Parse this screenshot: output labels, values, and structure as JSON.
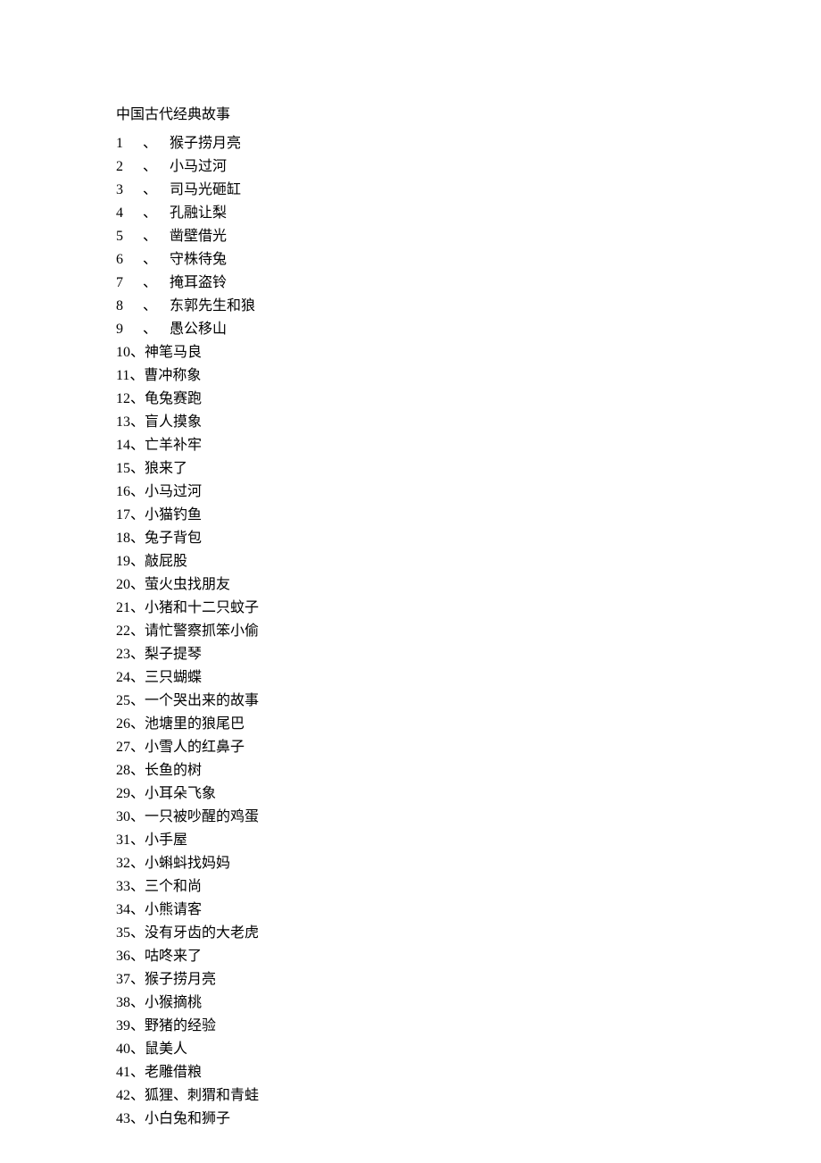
{
  "title": "中国古代经典故事",
  "items": [
    {
      "num": "1",
      "sep": "、",
      "text": "猴子捞月亮"
    },
    {
      "num": "2",
      "sep": "、",
      "text": "小马过河"
    },
    {
      "num": "3",
      "sep": "、",
      "text": "司马光砸缸"
    },
    {
      "num": "4",
      "sep": "、",
      "text": "孔融让梨"
    },
    {
      "num": "5",
      "sep": "、",
      "text": "凿壁借光"
    },
    {
      "num": "6",
      "sep": "、",
      "text": "守株待兔"
    },
    {
      "num": "7",
      "sep": "、",
      "text": "掩耳盗铃"
    },
    {
      "num": "8",
      "sep": "、",
      "text": "东郭先生和狼"
    },
    {
      "num": "9",
      "sep": "、",
      "text": "愚公移山"
    },
    {
      "num": "10",
      "sep": "、",
      "text": "神笔马良"
    },
    {
      "num": "11",
      "sep": "、",
      "text": "曹冲称象"
    },
    {
      "num": "12",
      "sep": "、",
      "text": "龟兔赛跑"
    },
    {
      "num": "13",
      "sep": "、",
      "text": "盲人摸象"
    },
    {
      "num": "14",
      "sep": "、",
      "text": "亡羊补牢"
    },
    {
      "num": "15",
      "sep": "、",
      "text": "狼来了"
    },
    {
      "num": "16",
      "sep": "、",
      "text": "小马过河"
    },
    {
      "num": "17",
      "sep": "、",
      "text": "小猫钓鱼"
    },
    {
      "num": "18",
      "sep": "、",
      "text": "兔子背包"
    },
    {
      "num": "19",
      "sep": "、",
      "text": "敲屁股"
    },
    {
      "num": "20",
      "sep": "、",
      "text": "萤火虫找朋友"
    },
    {
      "num": "21",
      "sep": "、",
      "text": "小猪和十二只蚊子"
    },
    {
      "num": "22",
      "sep": "、",
      "text": "请忙警察抓笨小偷"
    },
    {
      "num": "23",
      "sep": "、",
      "text": "梨子提琴"
    },
    {
      "num": "24",
      "sep": "、",
      "text": "三只蝴蝶"
    },
    {
      "num": "25",
      "sep": "、",
      "text": "一个哭出来的故事"
    },
    {
      "num": "26",
      "sep": "、",
      "text": "池塘里的狼尾巴"
    },
    {
      "num": "27",
      "sep": "、",
      "text": "小雪人的红鼻子"
    },
    {
      "num": "28",
      "sep": "、",
      "text": "长鱼的树"
    },
    {
      "num": "29",
      "sep": "、",
      "text": "小耳朵飞象"
    },
    {
      "num": "30",
      "sep": "、",
      "text": "一只被吵醒的鸡蛋"
    },
    {
      "num": "31",
      "sep": "、",
      "text": "小手屋"
    },
    {
      "num": "32",
      "sep": "、",
      "text": "小蝌蚪找妈妈"
    },
    {
      "num": "33",
      "sep": "、",
      "text": "三个和尚"
    },
    {
      "num": "34",
      "sep": "、",
      "text": "小熊请客"
    },
    {
      "num": "35",
      "sep": "、",
      "text": "没有牙齿的大老虎"
    },
    {
      "num": "36",
      "sep": "、",
      "text": "咕咚来了"
    },
    {
      "num": "37",
      "sep": "、",
      "text": "猴子捞月亮"
    },
    {
      "num": "38",
      "sep": "、",
      "text": "小猴摘桃"
    },
    {
      "num": "39",
      "sep": "、",
      "text": "野猪的经验"
    },
    {
      "num": "40",
      "sep": "、",
      "text": "鼠美人"
    },
    {
      "num": "41",
      "sep": "、",
      "text": "老雕借粮"
    },
    {
      "num": "42",
      "sep": "、",
      "text": "狐狸、刺猬和青蛙"
    },
    {
      "num": "43",
      "sep": "、",
      "text": "小白兔和狮子"
    }
  ]
}
